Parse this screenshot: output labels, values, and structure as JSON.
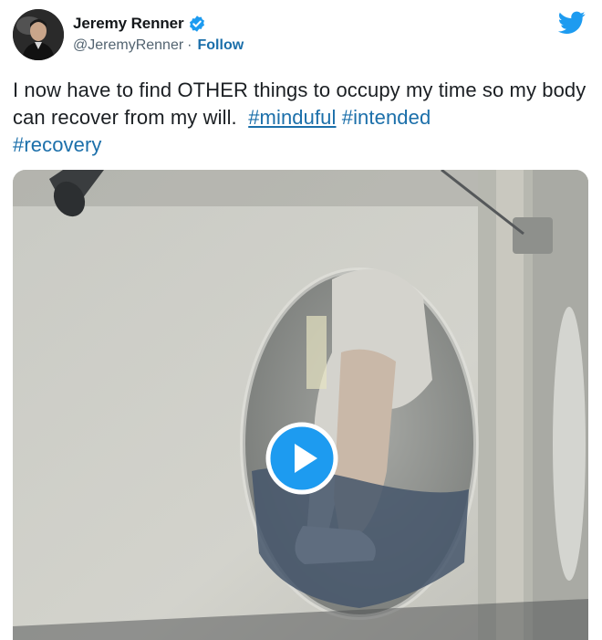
{
  "user": {
    "name": "Jeremy Renner",
    "handle": "@JeremyRenner",
    "separator": "·",
    "follow_label": "Follow",
    "verified": true,
    "avatar_icon": "avatar-photo"
  },
  "brand_icon": "twitter-bird-icon",
  "tweet": {
    "text_plain": "I now have to find OTHER things to occupy my time so my body can recover from my will.",
    "hashtags": [
      "#minduful",
      "#intended",
      "#recovery"
    ]
  },
  "media": {
    "type": "video",
    "play_icon": "play-icon"
  },
  "colors": {
    "link": "#1b6faa",
    "verified": "#1d9bf0",
    "twitter_blue": "#1d9bf0",
    "text": "#14171a",
    "secondary": "#536471"
  }
}
